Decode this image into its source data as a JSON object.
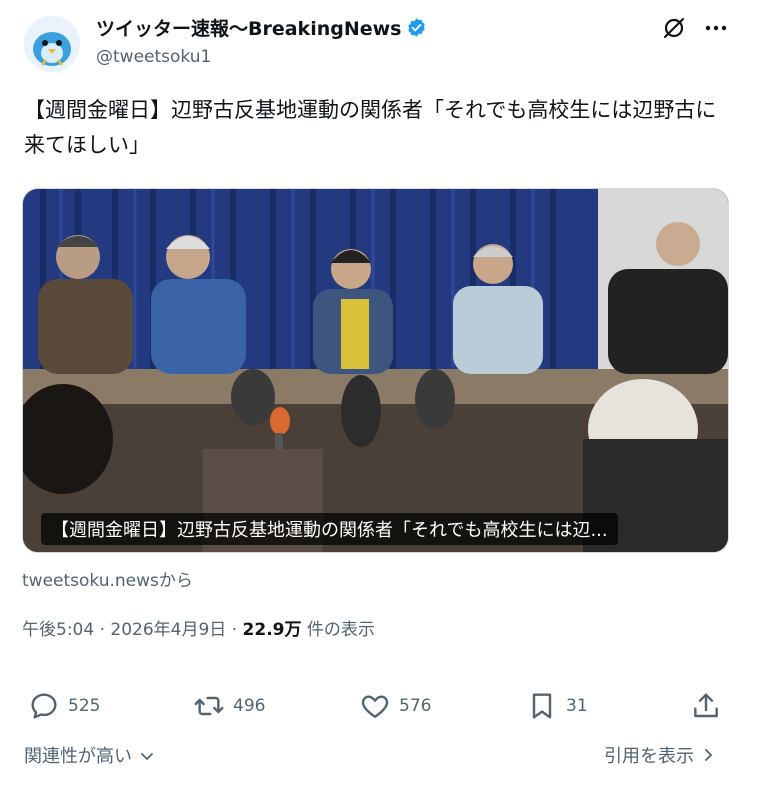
{
  "author": {
    "display_name": "ツイッター速報〜BreakingNews",
    "handle": "@tweetsoku1"
  },
  "tweet": {
    "text": "【週間金曜日】辺野古反基地運動の関係者「それでも高校生には辺野古に来てほしい」"
  },
  "card": {
    "caption": "【週間金曜日】辺野古反基地運動の関係者「それでも高校生には辺...",
    "source": "tweetsoku.newsから"
  },
  "meta": {
    "time": "午後5:04",
    "sep": "·",
    "date": "2026年4月9日",
    "views": "22.9万",
    "views_suffix": "件の表示"
  },
  "actions": {
    "replies": "525",
    "retweets": "496",
    "likes": "576",
    "bookmarks": "31"
  },
  "footer": {
    "sort_label": "関連性が高い",
    "quote_label": "引用を表示"
  },
  "colors": {
    "verified": "#1d9bf0",
    "text": "#0f1419",
    "muted": "#536471"
  },
  "icons": [
    "bird-avatar-icon",
    "verified-badge-icon",
    "grok-icon",
    "more-icon",
    "reply-icon",
    "retweet-icon",
    "like-icon",
    "bookmark-icon",
    "share-icon",
    "chevron-down-icon",
    "chevron-right-icon"
  ]
}
